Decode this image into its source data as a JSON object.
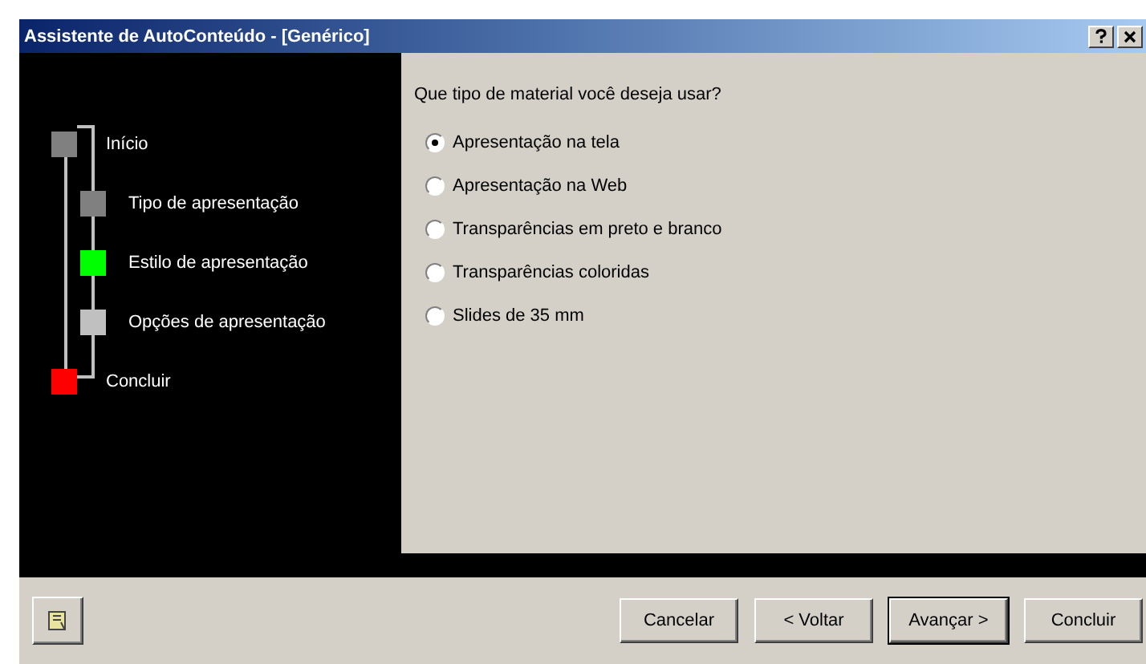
{
  "window": {
    "title": "Assistente de AutoConteúdo - [Genérico]",
    "title_buttons": [
      {
        "kind": "help"
      },
      {
        "kind": "close"
      }
    ]
  },
  "steps": [
    {
      "label": "Início",
      "color": "#808080",
      "children": [
        {
          "label": "Tipo de apresentação",
          "color": "#808080"
        },
        {
          "label": "Estilo de apresentação",
          "color": "#00ff00"
        },
        {
          "label": "Opções de apresentação",
          "color": "#c0c0c0"
        }
      ]
    },
    {
      "label": "Concluir",
      "color": "#ff0000"
    }
  ],
  "question": "Que tipo de material você deseja usar?",
  "options": [
    {
      "label": "Apresentação na tela",
      "selected": true
    },
    {
      "label": "Apresentação na Web",
      "selected": false
    },
    {
      "label": "Transparências em preto e branco",
      "selected": false
    },
    {
      "label": "Transparências coloridas",
      "selected": false
    },
    {
      "label": "Slides de 35 mm",
      "selected": false
    }
  ],
  "buttons": [
    {
      "label": "Cancelar",
      "default": false
    },
    {
      "label": "< Voltar",
      "default": false
    },
    {
      "label": "Avançar >",
      "default": true
    },
    {
      "label": "Concluir",
      "default": false
    }
  ]
}
